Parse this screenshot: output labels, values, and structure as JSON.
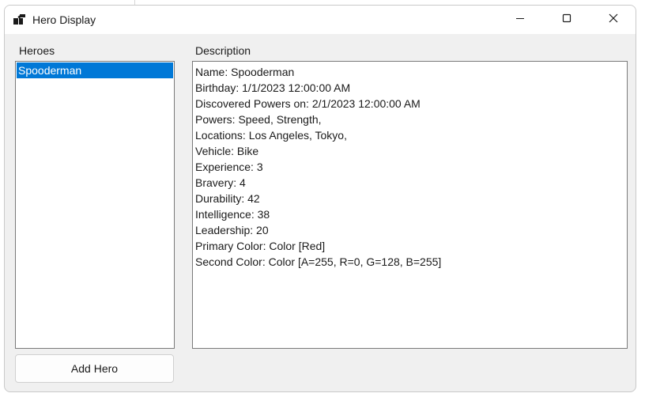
{
  "window": {
    "title": "Hero Display",
    "icon": "app-window-icon",
    "controls": {
      "minimize_icon": "minimize-icon",
      "maximize_icon": "maximize-icon",
      "close_icon": "close-icon"
    }
  },
  "heroes_panel": {
    "label": "Heroes",
    "items": [
      "Spooderman"
    ],
    "selected": "Spooderman",
    "selection_color": "#0078d7"
  },
  "description_panel": {
    "label": "Description",
    "lines": [
      "Name: Spooderman",
      "Birthday: 1/1/2023 12:00:00 AM",
      "Discovered Powers on: 2/1/2023 12:00:00 AM",
      "Powers: Speed, Strength,",
      "Locations: Los Angeles, Tokyo,",
      "Vehicle: Bike",
      "Experience: 3",
      "Bravery: 4",
      "Durability: 42",
      "Intelligence: 38",
      "Leadership: 20",
      "Primary Color: Color [Red]",
      "Second Color: Color [A=255, R=0, G=128, B=255]"
    ]
  },
  "actions": {
    "add_hero_label": "Add Hero"
  }
}
